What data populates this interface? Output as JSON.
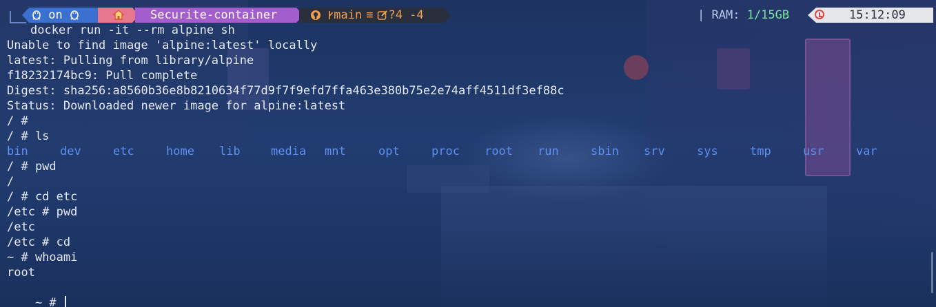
{
  "prompt_bar": {
    "os_label": "on",
    "directory": "Securite-container",
    "git_branch": "main",
    "git_equiv": "≡",
    "git_status": "?4 -4",
    "ram_label": "RAM:",
    "ram_value": "1/15GB",
    "separator": "|",
    "time": "15:12:09"
  },
  "terminal": {
    "command": "docker run -it --rm alpine sh",
    "output_lines": [
      "Unable to find image 'alpine:latest' locally",
      "latest: Pulling from library/alpine",
      "f18232174bc9: Pull complete",
      "Digest: sha256:a8560b36e8b8210634f77d9f7f9efd7ffa463e380b75e2e74aff4511df3ef88c",
      "Status: Downloaded newer image for alpine:latest",
      "/ #",
      "/ # ls"
    ],
    "ls_entries": [
      "bin",
      "dev",
      "etc",
      "home",
      "lib",
      "media",
      "mnt",
      "opt",
      "proc",
      "root",
      "run",
      "sbin",
      "srv",
      "sys",
      "tmp",
      "usr",
      "var"
    ],
    "after_lines": [
      "/ # pwd",
      "/",
      "/ # cd etc",
      "/etc # pwd",
      "/etc",
      "/etc # cd",
      "~ # whoami",
      "root"
    ],
    "current_prompt": "~ # "
  },
  "colors": {
    "background": "#1e3566",
    "text": "#e4e9f5",
    "directory_listing": "#5f8ff0",
    "os_segment": "#3b6fd0",
    "home_segment": "#e7778c",
    "path_segment": "#a35dcc",
    "git_segment": "#2a2f3e",
    "git_text": "#f0a050",
    "ram_value": "#7de3a0",
    "time_segment": "#e6e7ea"
  },
  "icons": {
    "os": "linux-tux-icon",
    "home": "home-icon",
    "git": "github-icon",
    "branch": "git-branch-icon",
    "edited": "pencil-square-icon",
    "clock": "alarm-clock-icon"
  }
}
